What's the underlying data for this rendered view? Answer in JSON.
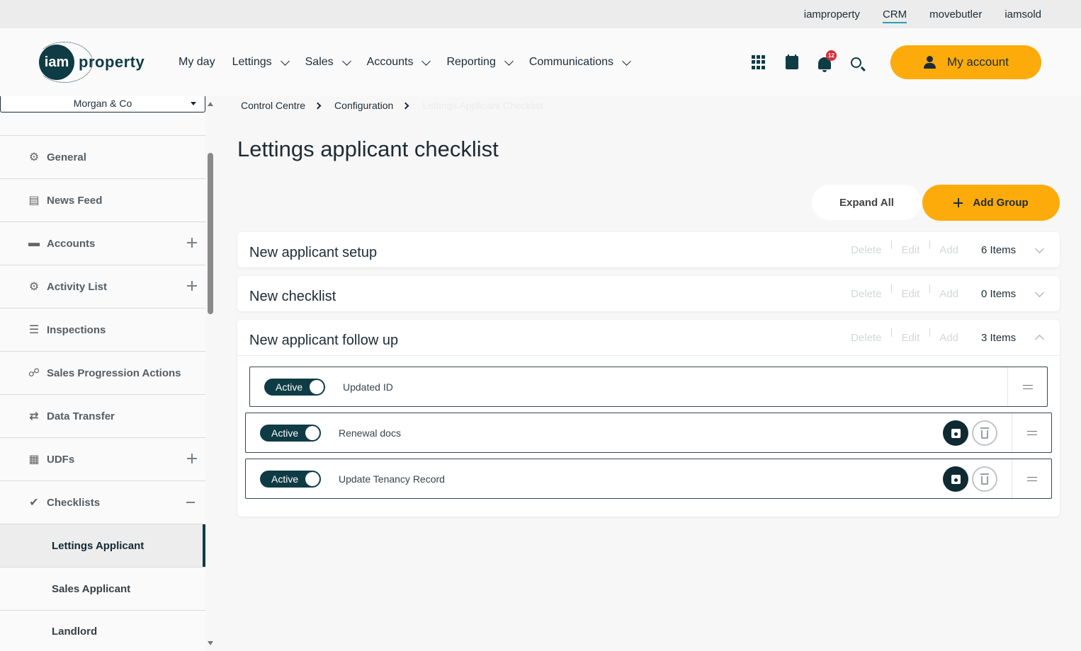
{
  "topbar": {
    "links": [
      "iamproperty",
      "CRM",
      "movebutler",
      "iamsold"
    ],
    "active": "CRM"
  },
  "logo": {
    "mark": "iam",
    "word": "property"
  },
  "nav": {
    "my_day": "My day",
    "lettings": "Lettings",
    "sales": "Sales",
    "accounts": "Accounts",
    "reporting": "Reporting",
    "communications": "Communications"
  },
  "header": {
    "notification_count": "12",
    "account_label": "My account"
  },
  "sidebar": {
    "branch": "Morgan & Co",
    "items": [
      {
        "label": "General",
        "icon": "gear-icon"
      },
      {
        "label": "News Feed",
        "icon": "newspaper-icon"
      },
      {
        "label": "Accounts",
        "icon": "card-icon"
      },
      {
        "label": "Activity List",
        "icon": "gear-icon"
      },
      {
        "label": "Inspections",
        "icon": "checklist-icon"
      },
      {
        "label": "Sales Progression Actions",
        "icon": "webhook-icon"
      },
      {
        "label": "Data Transfer",
        "icon": "transfer-icon"
      },
      {
        "label": "UDFs",
        "icon": "list-icon"
      },
      {
        "label": "Checklists",
        "icon": "check-circle-icon"
      }
    ],
    "sub_items": [
      {
        "label": "Lettings Applicant"
      },
      {
        "label": "Sales Applicant"
      },
      {
        "label": "Landlord"
      }
    ]
  },
  "breadcrumb": {
    "first": "Control Centre",
    "second": "Configuration",
    "current": "Lettings Applicant Checklist"
  },
  "page": {
    "title": "Lettings applicant checklist"
  },
  "buttons": {
    "expand_all": "Expand All",
    "add_group": "Add Group"
  },
  "group_actions": {
    "delete": "Delete",
    "edit": "Edit",
    "add": "Add"
  },
  "groups": [
    {
      "title": "New applicant setup",
      "count": "6 Items"
    },
    {
      "title": "New checklist",
      "count": "0 Items"
    },
    {
      "title": "New applicant follow up",
      "count": "3 Items"
    }
  ],
  "checklist_items": [
    {
      "status": "Active",
      "label": "Updated ID"
    },
    {
      "status": "Active",
      "label": "Renewal docs"
    },
    {
      "status": "Active",
      "label": "Update Tenancy Record"
    }
  ],
  "colors": {
    "accent": "#fcab0a",
    "primary_dark": "#0f3b45",
    "badge": "#d6303a"
  }
}
